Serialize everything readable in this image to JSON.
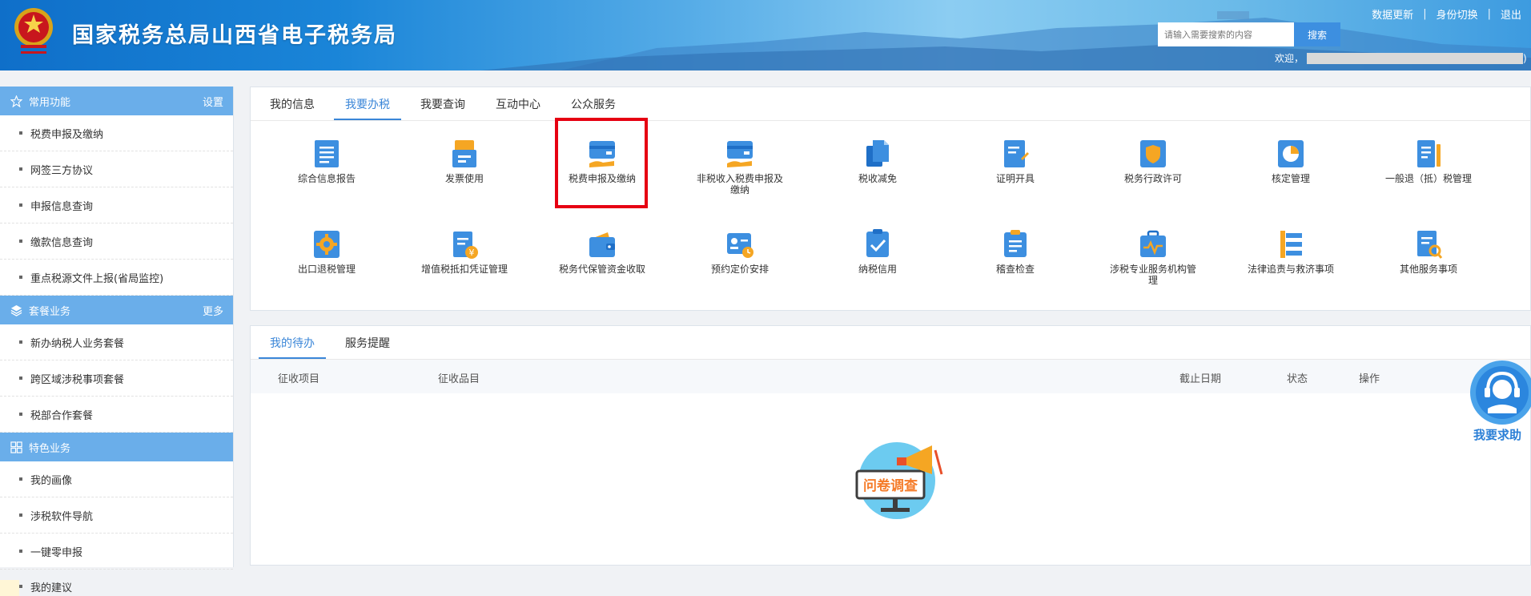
{
  "header": {
    "title": "国家税务总局山西省电子税务局",
    "links": [
      "数据更新",
      "身份切换",
      "退出"
    ],
    "search_placeholder": "请输入需要搜索的内容",
    "search_button": "搜索",
    "welcome": "欢迎，",
    "welcome_tail": ")"
  },
  "sidebar": {
    "common": {
      "title": "常用功能",
      "action": "设置",
      "items": [
        "税费申报及缴纳",
        "网签三方协议",
        "申报信息查询",
        "缴款信息查询",
        "重点税源文件上报(省局监控)"
      ]
    },
    "packages": {
      "title": "套餐业务",
      "action": "更多",
      "items": [
        "新办纳税人业务套餐",
        "跨区域涉税事项套餐",
        "税部合作套餐"
      ]
    },
    "special": {
      "title": "特色业务",
      "items": [
        "我的画像",
        "涉税软件导航",
        "一键零申报"
      ]
    },
    "feedback": "我的建议"
  },
  "main": {
    "tabs": [
      "我的信息",
      "我要办税",
      "我要查询",
      "互动中心",
      "公众服务"
    ],
    "active_tab": "我要办税",
    "services": [
      "综合信息报告",
      "发票使用",
      "税费申报及缴纳",
      "非税收入税费申报及缴纳",
      "税收减免",
      "证明开具",
      "税务行政许可",
      "核定管理",
      "一般退（抵）税管理",
      "出口退税管理",
      "增值税抵扣凭证管理",
      "税务代保管资金收取",
      "预约定价安排",
      "纳税信用",
      "稽查检查",
      "涉税专业服务机构管理",
      "法律追责与救济事项",
      "其他服务事项"
    ],
    "highlighted_service": "税费申报及缴纳"
  },
  "todo": {
    "tabs": [
      "我的待办",
      "服务提醒"
    ],
    "columns": [
      "征收项目",
      "征收品目",
      "截止日期",
      "状态",
      "操作"
    ],
    "survey_label": "问卷调查"
  },
  "help": {
    "label": "我要求助"
  },
  "colors": {
    "accent": "#3a86d8",
    "sidebar_header": "#6aaeea",
    "highlight": "#e60012",
    "icon_blue": "#3d8fe0",
    "icon_orange": "#f5a623"
  }
}
